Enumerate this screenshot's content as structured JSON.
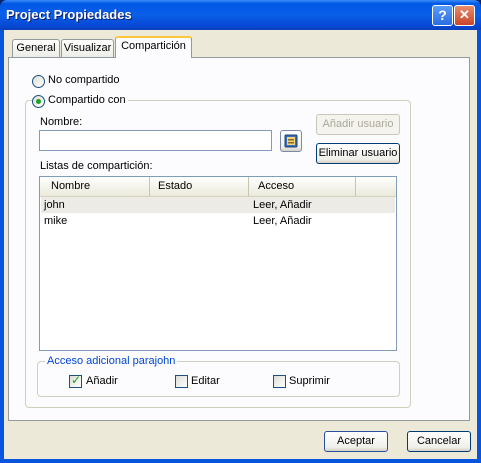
{
  "window": {
    "title": "Project Propiedades",
    "help_icon": "?",
    "close_icon": "✕"
  },
  "tabs": [
    {
      "label": "General"
    },
    {
      "label": "Visualizar"
    },
    {
      "label": "Compartición",
      "active": true
    }
  ],
  "sharing": {
    "not_shared_label": "No compartido",
    "shared_with_label": "Compartido con",
    "selected": "shared",
    "name_label": "Nombre:",
    "name_value": "",
    "add_user_label": "Añadir usuario",
    "remove_user_label": "Eliminar usuario",
    "share_list_label": "Listas de compartición:",
    "columns": [
      "Nombre",
      "Estado",
      "Acceso"
    ],
    "rows": [
      {
        "name": "john",
        "status": "",
        "access": "Leer, Añadir"
      },
      {
        "name": "mike",
        "status": "",
        "access": "Leer, Añadir"
      }
    ],
    "extra_access_title": "Acceso adicional parajohn",
    "options": [
      {
        "label": "Añadir",
        "checked": true
      },
      {
        "label": "Editar",
        "checked": false
      },
      {
        "label": "Suprimir",
        "checked": false
      }
    ]
  },
  "footer": {
    "ok_label": "Aceptar",
    "cancel_label": "Cancelar"
  }
}
